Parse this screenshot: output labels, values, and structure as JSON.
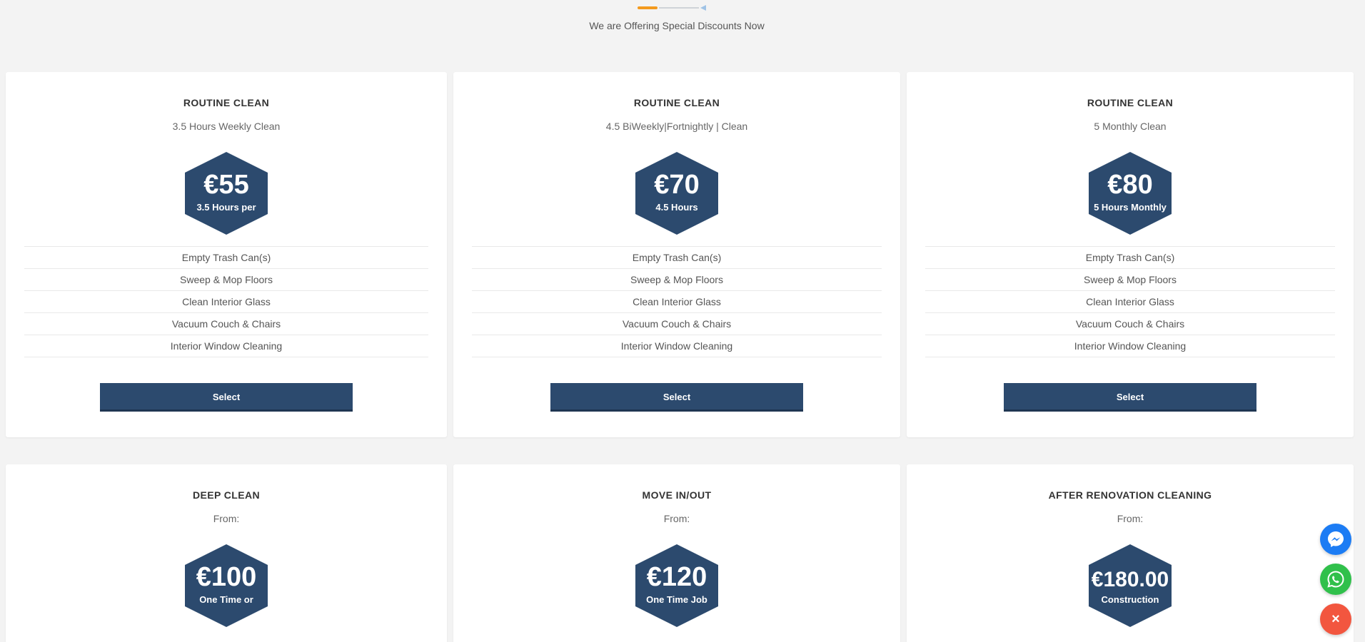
{
  "header": {
    "tagline": "We are Offering Special Discounts Now"
  },
  "plans": [
    {
      "title": "ROUTINE CLEAN",
      "subtitle": "3.5 Hours Weekly Clean",
      "price": "€55",
      "price_note": "3.5 Hours per",
      "features": [
        "Empty Trash Can(s)",
        "Sweep & Mop Floors",
        "Clean Interior Glass",
        "Vacuum Couch & Chairs",
        "Interior Window Cleaning"
      ],
      "button": "Select"
    },
    {
      "title": "ROUTINE CLEAN",
      "subtitle": "4.5 BiWeekly|Fortnightly | Clean",
      "price": "€70",
      "price_note": "4.5 Hours",
      "features": [
        "Empty Trash Can(s)",
        "Sweep & Mop Floors",
        "Clean Interior Glass",
        "Vacuum Couch & Chairs",
        "Interior Window Cleaning"
      ],
      "button": "Select"
    },
    {
      "title": "ROUTINE CLEAN",
      "subtitle": "5 Monthly Clean",
      "price": "€80",
      "price_note": "5 Hours Monthly",
      "features": [
        "Empty Trash Can(s)",
        "Sweep & Mop Floors",
        "Clean Interior Glass",
        "Vacuum Couch & Chairs",
        "Interior Window Cleaning"
      ],
      "button": "Select"
    },
    {
      "title": "DEEP CLEAN",
      "subtitle": "From:",
      "price": "€100",
      "price_note": "One Time or"
    },
    {
      "title": "MOVE IN/OUT",
      "subtitle": "From:",
      "price": "€120",
      "price_note": "One Time Job"
    },
    {
      "title": "AFTER RENOVATION CLEANING",
      "subtitle": "From:",
      "price": "€180.00",
      "price_note": "Construction"
    }
  ],
  "floating": {
    "close_label": "×"
  },
  "colors": {
    "accent": "#2c4a6e",
    "orange": "#f39a1e",
    "messenger": "#1c7cf4",
    "whatsapp": "#30c04b",
    "close": "#f2563f"
  }
}
